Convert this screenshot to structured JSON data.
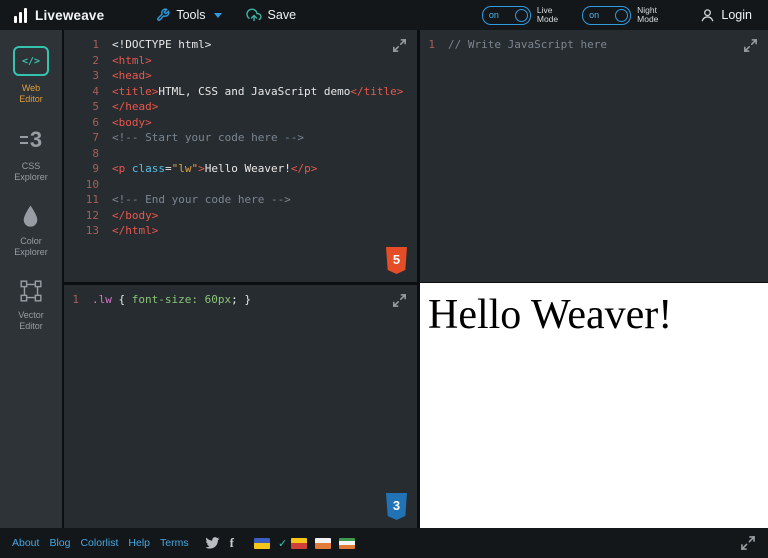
{
  "topbar": {
    "logo_text": "Liveweave",
    "tools_label": "Tools",
    "save_label": "Save",
    "live_toggle_state": "on",
    "live_mode_label_line1": "Live",
    "live_mode_label_line2": "Mode",
    "night_toggle_state": "on",
    "night_mode_label_line1": "Night",
    "night_mode_label_line2": "Mode",
    "login_label": "Login"
  },
  "sidebar": {
    "items": [
      {
        "icon": "code-brackets-icon",
        "icon_glyph": "</>",
        "label_line1": "Web",
        "label_line2": "Editor",
        "active": true
      },
      {
        "icon": "css3-icon",
        "icon_glyph": "3",
        "label_line1": "CSS",
        "label_line2": "Explorer",
        "active": false
      },
      {
        "icon": "droplet-icon",
        "icon_glyph": "",
        "label_line1": "Color",
        "label_line2": "Explorer",
        "active": false
      },
      {
        "icon": "vector-frame-icon",
        "icon_glyph": "",
        "label_line1": "Vector",
        "label_line2": "Editor",
        "active": false
      }
    ]
  },
  "editors": {
    "html": {
      "badge": "5",
      "lines": [
        {
          "num": "1",
          "tokens": [
            [
              "plain",
              "<!DOCTYPE html>"
            ]
          ]
        },
        {
          "num": "2",
          "tokens": [
            [
              "tag",
              "<html>"
            ]
          ]
        },
        {
          "num": "3",
          "tokens": [
            [
              "tag",
              "<head>"
            ]
          ]
        },
        {
          "num": "4",
          "tokens": [
            [
              "tag",
              "<title>"
            ],
            [
              "plain",
              "HTML, CSS and JavaScript demo"
            ],
            [
              "tag",
              "</title>"
            ]
          ]
        },
        {
          "num": "5",
          "tokens": [
            [
              "tag",
              "</head>"
            ]
          ]
        },
        {
          "num": "6",
          "tokens": [
            [
              "tag",
              "<body>"
            ]
          ]
        },
        {
          "num": "7",
          "tokens": [
            [
              "comment",
              "<!-- Start your code here -->"
            ]
          ]
        },
        {
          "num": "8",
          "tokens": []
        },
        {
          "num": "9",
          "tokens": [
            [
              "tag",
              "<p"
            ],
            [
              "plain",
              " "
            ],
            [
              "attr",
              "class"
            ],
            [
              "plain",
              "="
            ],
            [
              "string",
              "\"lw\""
            ],
            [
              "tag",
              ">"
            ],
            [
              "plain",
              "Hello Weaver!"
            ],
            [
              "tag",
              "</p>"
            ]
          ]
        },
        {
          "num": "10",
          "tokens": []
        },
        {
          "num": "11",
          "tokens": [
            [
              "comment",
              "<!-- End your code here -->"
            ]
          ]
        },
        {
          "num": "12",
          "tokens": [
            [
              "tag",
              "</body>"
            ]
          ]
        },
        {
          "num": "13",
          "tokens": [
            [
              "tag",
              "</html>"
            ]
          ]
        }
      ]
    },
    "css": {
      "badge": "3",
      "lines": [
        {
          "num": "1",
          "tokens": [
            [
              "selector",
              ".lw"
            ],
            [
              "plain",
              " { "
            ],
            [
              "property",
              "font-size:"
            ],
            [
              "plain",
              " "
            ],
            [
              "value",
              "60px"
            ],
            [
              "plain",
              "; }"
            ]
          ]
        }
      ]
    },
    "js": {
      "lines": [
        {
          "num": "1",
          "tokens": [
            [
              "comment",
              "// Write JavaScript here"
            ]
          ]
        }
      ]
    }
  },
  "preview": {
    "text": "Hello Weaver!"
  },
  "footer": {
    "links": [
      "About",
      "Blog",
      "Colorlist",
      "Help",
      "Terms"
    ],
    "facebook_glyph": "f",
    "check_mark": "✓",
    "flags": [
      {
        "name": "flag-icon-1",
        "stripes": [
          "#3b5fc0",
          "#f5c518"
        ]
      },
      {
        "name": "flag-icon-2",
        "stripes": [
          "#f5c518",
          "#d04038"
        ]
      },
      {
        "name": "flag-icon-3",
        "stripes": [
          "#f2f2f2",
          "#e07b39"
        ]
      },
      {
        "name": "flag-icon-4",
        "stripes": [
          "#3d9b4f",
          "#f5f5f5",
          "#e07b39"
        ]
      }
    ]
  },
  "colors": {
    "accent_blue": "#2f9be0",
    "accent_teal": "#35c3b0",
    "active_label_orange": "#dd9e3e",
    "link_cyan": "#45a7e0",
    "html5_badge": "#e44d26",
    "css3_badge": "#2173b6",
    "tag_red": "#e8574d",
    "line_number": "#a85f58",
    "editor_bg": "#272c30"
  }
}
